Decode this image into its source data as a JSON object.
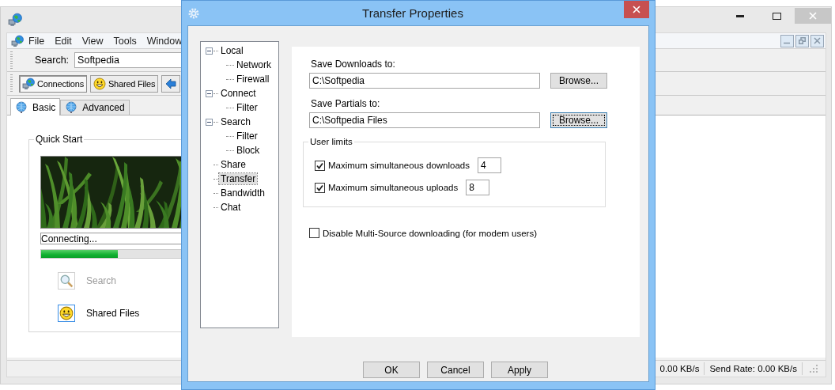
{
  "main_window": {
    "menu": [
      "File",
      "Edit",
      "View",
      "Tools",
      "Window"
    ],
    "search": {
      "label": "Search:",
      "value": "Softpedia"
    },
    "toolbar": [
      {
        "kind": "network",
        "label": "Connections",
        "selected": true
      },
      {
        "kind": "smiley",
        "label": "Shared Files",
        "selected": false
      },
      {
        "kind": "arrow"
      }
    ],
    "tabs": [
      {
        "label": "Basic",
        "selected": true
      },
      {
        "label": "Advanced",
        "selected": false
      }
    ],
    "quick_start": {
      "title": "Quick Start",
      "status": "Connecting...",
      "progress": {
        "level": 0.35
      },
      "actions": [
        {
          "kind": "search",
          "label": "Search",
          "disabled": true
        },
        {
          "kind": "smiley",
          "label": "Shared Files",
          "disabled": false
        }
      ]
    },
    "status_bar": [
      "0.00 KB/s",
      "Send Rate: 0.00 KB/s"
    ]
  },
  "dialog": {
    "title": "Transfer Properties",
    "tree": [
      {
        "label": "Local",
        "expanded": true,
        "selected": false,
        "children": [
          {
            "label": "Network",
            "selected": false
          },
          {
            "label": "Firewall",
            "selected": false
          }
        ]
      },
      {
        "label": "Connect",
        "expanded": true,
        "selected": false,
        "children": [
          {
            "label": "Filter",
            "selected": false
          }
        ]
      },
      {
        "label": "Search",
        "expanded": true,
        "selected": false,
        "children": [
          {
            "label": "Filter",
            "selected": false
          },
          {
            "label": "Block",
            "selected": false
          }
        ]
      },
      {
        "label": "Share",
        "selected": false
      },
      {
        "label": "Transfer",
        "selected": true
      },
      {
        "label": "Bandwidth",
        "selected": false
      },
      {
        "label": "Chat",
        "selected": false
      }
    ],
    "paths": [
      {
        "label": "Save Downloads to:",
        "value": "C:\\Softpedia",
        "button": "Browse...",
        "focused": false
      },
      {
        "label": "Save Partials to:",
        "value": "C:\\Softpedia Files",
        "button": "Browse...",
        "focused": true
      }
    ],
    "user_limits": {
      "title": "User limits",
      "rows": [
        {
          "label": "Maximum simultaneous downloads",
          "checked": true,
          "value": "4"
        },
        {
          "label": "Maximum simultaneous uploads",
          "checked": true,
          "value": "8"
        }
      ]
    },
    "multi_source": {
      "label": "Disable Multi-Source downloading (for modem users)",
      "checked": false
    },
    "buttons": [
      "OK",
      "Cancel",
      "Apply"
    ]
  }
}
